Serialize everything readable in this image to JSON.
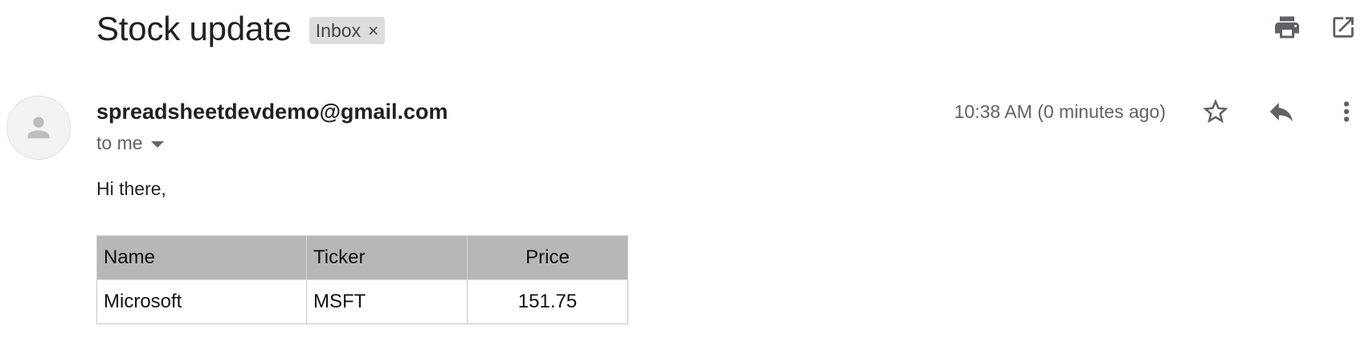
{
  "email": {
    "subject": "Stock update",
    "label": {
      "text": "Inbox",
      "remove_glyph": "×"
    },
    "header_actions": [
      {
        "icon": "print-icon",
        "label": "Print all"
      },
      {
        "icon": "open-in-new-window-icon",
        "label": "In new window"
      }
    ],
    "sender": {
      "address": "spreadsheetdevdemo@gmail.com",
      "avatar_icon": "person-icon",
      "recipient_text": "to me"
    },
    "timestamp": "10:38 AM (0 minutes ago)",
    "message_actions": [
      {
        "icon": "star-outline-icon"
      },
      {
        "icon": "reply-icon"
      },
      {
        "icon": "more-vertical-icon"
      }
    ]
  },
  "body": {
    "greeting": "Hi there,",
    "table": {
      "headers": [
        "Name",
        "Ticker",
        "Price"
      ],
      "rows": [
        [
          "Microsoft",
          "MSFT",
          "151.75"
        ]
      ]
    }
  },
  "colors": {
    "icon": "#5f6368",
    "table_header_bg": "#b7b7b7",
    "chip_bg": "#dddddd",
    "avatar_bg": "#f1f3f4"
  }
}
